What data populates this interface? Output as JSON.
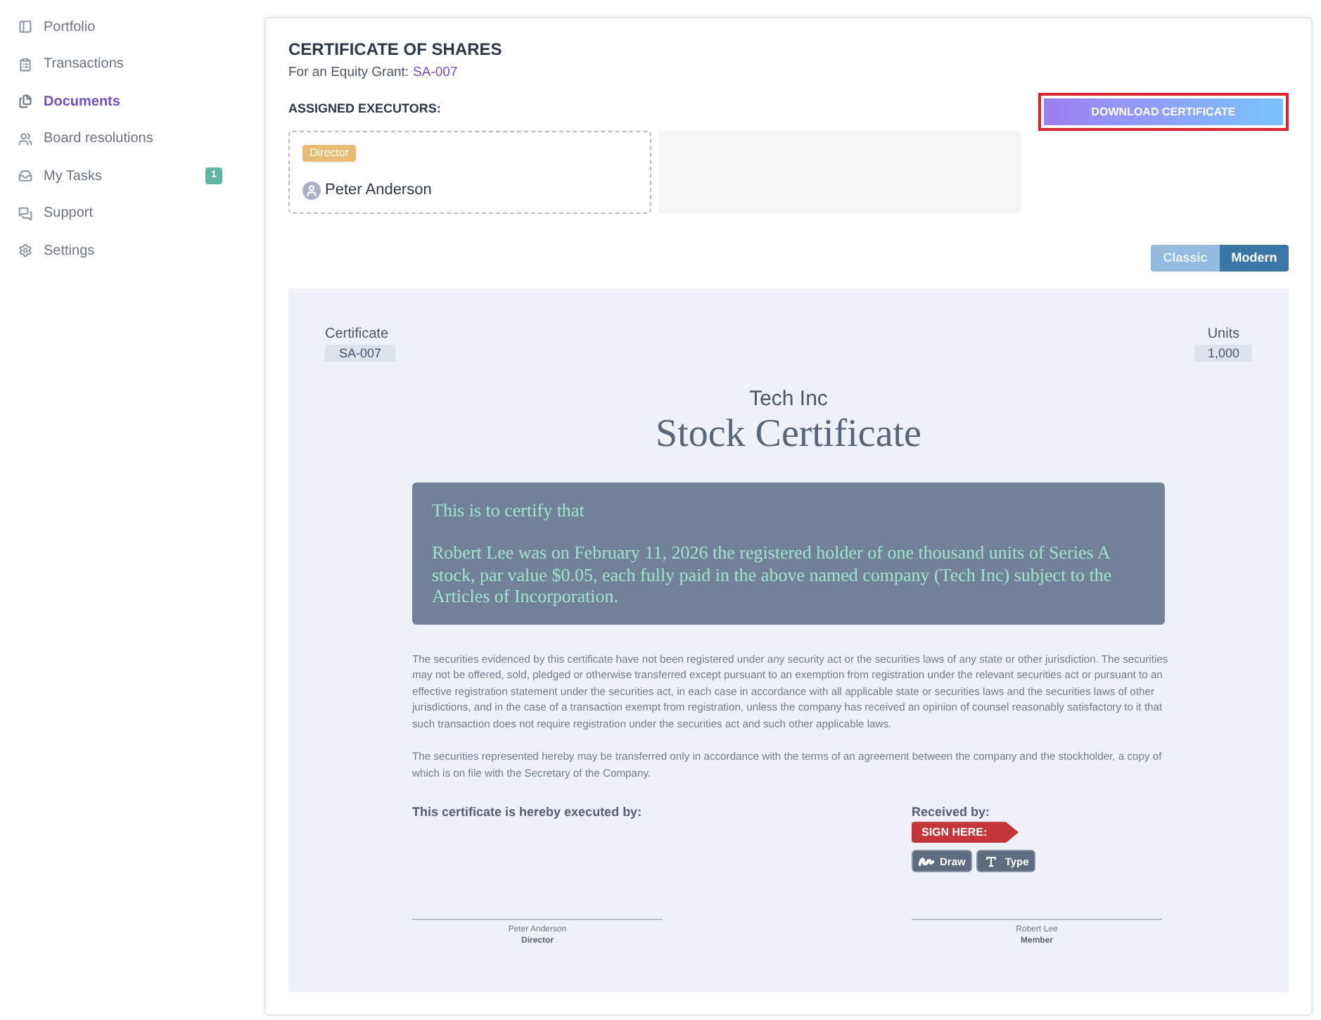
{
  "sidebar": {
    "items": [
      {
        "label": "Portfolio",
        "selected": false
      },
      {
        "label": "Transactions",
        "selected": false
      },
      {
        "label": "Documents",
        "selected": true
      },
      {
        "label": "Board resolutions",
        "selected": false
      },
      {
        "label": "My Tasks",
        "selected": false,
        "badge": "1"
      },
      {
        "label": "Support",
        "selected": false
      },
      {
        "label": "Settings",
        "selected": false
      }
    ]
  },
  "header": {
    "title": "CERTIFICATE OF SHARES",
    "subtitle": "For an Equity Grant:",
    "grant_link": "SA-007",
    "executors_label": "ASSIGNED EXECUTORS:",
    "download_button": "DOWNLOAD CERTIFICATE"
  },
  "executors": [
    {
      "role": "Director",
      "name": "Peter Anderson"
    }
  ],
  "style_toggle": [
    {
      "label": "Classic",
      "selected": false
    },
    {
      "label": "Modern",
      "selected": true
    }
  ],
  "certificate": {
    "number_label": "Certificate",
    "number": "SA-007",
    "units_label": "Units",
    "units": "1,000",
    "company": "Tech Inc",
    "title": "Stock Certificate",
    "statement": {
      "intro": "This is to certify that",
      "body": "Robert Lee was on February 11, 2026 the registered holder of one thousand units of Series A stock, par value $0.05, each fully paid in the above named company (Tech Inc) subject to the Articles of Incorporation."
    },
    "legal": [
      "The securities evidenced by this certificate have not been registered under any security act or the securities laws of any state or other jurisdiction. The securities may not be offered, sold, pledged or otherwise transferred except pursuant to an exemption from registration under the relevant securities act or pursuant to an effective registration statement under the securities act, in each case in accordance with all applicable state or securities laws and the securities laws of other jurisdictions, and in the case of a transaction exempt from registration, unless the company has received an opinion of counsel reasonably satisfactory to it that such transaction does not require registration under the securities act and such other applicable laws.",
      "The securities represented hereby may be transferred only in accordance with the terms of an agreement between the company and the stockholder, a copy of which is on file with the Secretary of the Company."
    ],
    "executed_by": "This certificate is hereby executed by:",
    "received_by": "Received by:",
    "sign_here": "SIGN HERE:",
    "sign_options": [
      {
        "kind": "draw",
        "label": "Draw"
      },
      {
        "kind": "type",
        "label": "Type"
      }
    ],
    "signatures": [
      {
        "name": "Peter Anderson",
        "role": "Director"
      },
      {
        "name": "Robert Lee",
        "role": "Member"
      }
    ]
  }
}
